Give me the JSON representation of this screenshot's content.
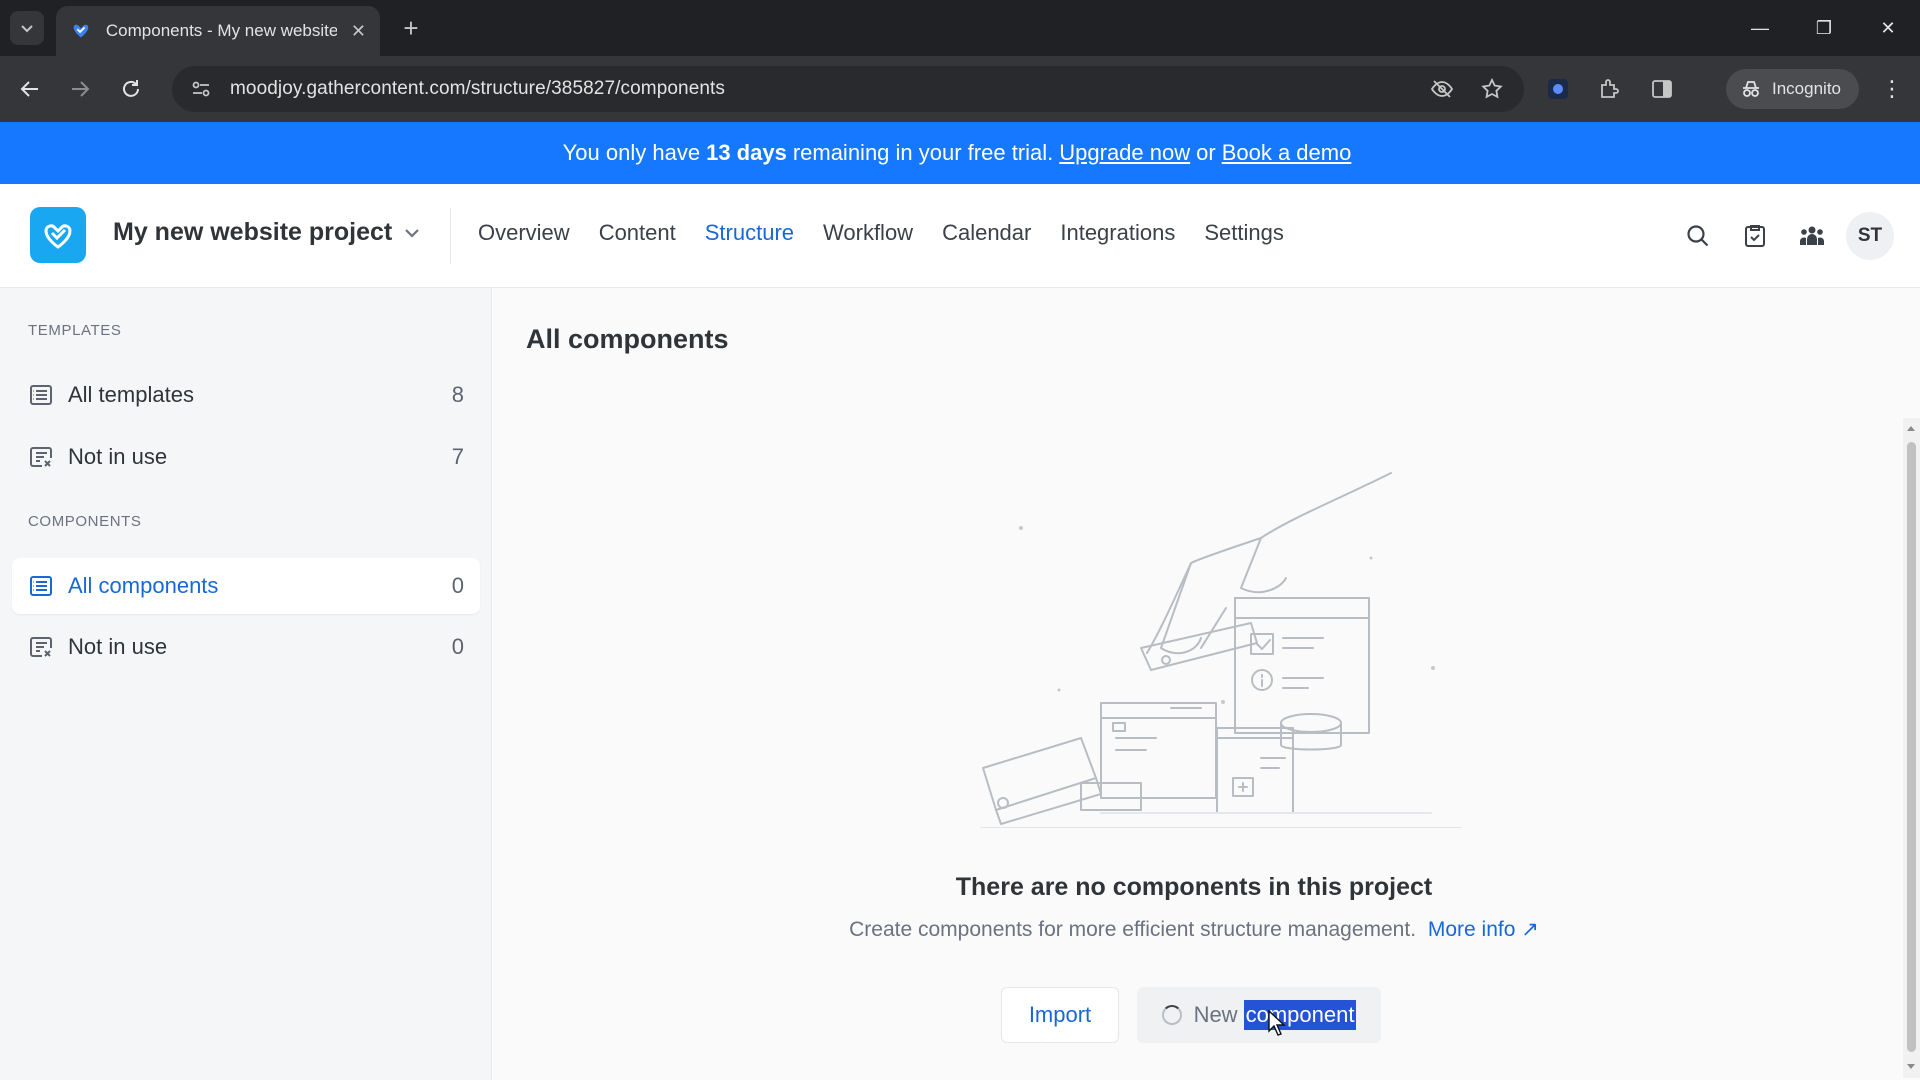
{
  "browser": {
    "tab_title": "Components - My new website",
    "url": "moodjoy.gathercontent.com/structure/385827/components",
    "incognito_label": "Incognito"
  },
  "banner": {
    "prefix": "You only have",
    "days": "13 days",
    "middle": "remaining in your free trial.",
    "upgrade_link": "Upgrade now",
    "or": "or",
    "demo_link": "Book a demo"
  },
  "header": {
    "project_name": "My new website project",
    "nav": [
      {
        "label": "Overview"
      },
      {
        "label": "Content"
      },
      {
        "label": "Structure"
      },
      {
        "label": "Workflow"
      },
      {
        "label": "Calendar"
      },
      {
        "label": "Integrations"
      },
      {
        "label": "Settings"
      }
    ],
    "active_nav": "Structure",
    "avatar_initials": "ST",
    "accent_color": "#1769d6",
    "banner_color": "#1677ff"
  },
  "sidebar": {
    "templates_heading": "TEMPLATES",
    "templates": [
      {
        "label": "All templates",
        "count": "8"
      },
      {
        "label": "Not in use",
        "count": "7"
      }
    ],
    "components_heading": "COMPONENTS",
    "components": [
      {
        "label": "All components",
        "count": "0"
      },
      {
        "label": "Not in use",
        "count": "0"
      }
    ]
  },
  "main": {
    "title": "All components",
    "empty_title": "There are no components in this project",
    "empty_subtitle": "Create components for more efficient structure management.",
    "more_info": "More info ↗",
    "import_button": "Import",
    "new_button_prefix": "New",
    "new_button_selected": "component"
  }
}
